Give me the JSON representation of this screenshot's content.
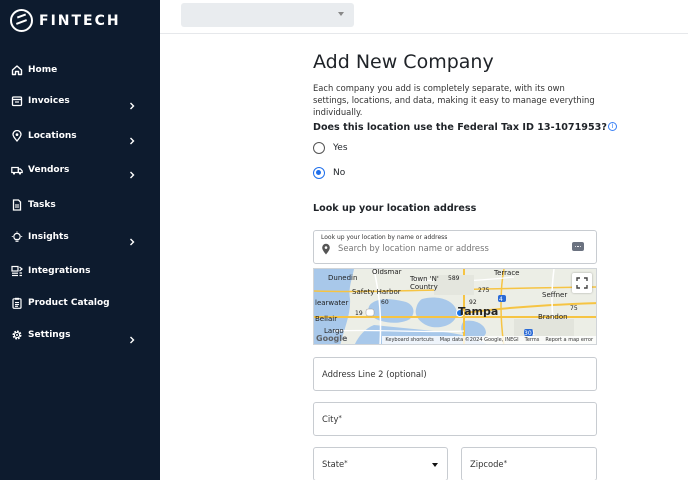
{
  "app": {
    "name": "FINTECH"
  },
  "sidebar": {
    "items": [
      {
        "label": "Home",
        "icon": "home-icon",
        "has_submenu": false
      },
      {
        "label": "Invoices",
        "icon": "invoice-icon",
        "has_submenu": true
      },
      {
        "label": "Locations",
        "icon": "location-pin-icon",
        "has_submenu": true
      },
      {
        "label": "Vendors",
        "icon": "truck-icon",
        "has_submenu": true
      },
      {
        "label": "Tasks",
        "icon": "document-icon",
        "has_submenu": false
      },
      {
        "label": "Insights",
        "icon": "lightbulb-icon",
        "has_submenu": true
      },
      {
        "label": "Integrations",
        "icon": "integrations-icon",
        "has_submenu": false
      },
      {
        "label": "Product Catalog",
        "icon": "clipboard-icon",
        "has_submenu": false
      },
      {
        "label": "Settings",
        "icon": "gear-icon",
        "has_submenu": true
      }
    ]
  },
  "page": {
    "title": "Add New Company",
    "description": "Each company you add is completely separate, with its own settings, locations, and data, making it easy to manage everything individually.",
    "tax_question": "Does this location use the Federal Tax ID 13-1071953?",
    "tax_options": [
      {
        "label": "Yes",
        "selected": false
      },
      {
        "label": "No",
        "selected": true
      }
    ],
    "address_section_title": "Look up your location address",
    "lookup": {
      "label": "Look up your location by name or address",
      "placeholder": "Search by location name or address"
    },
    "map": {
      "places": [
        "Oldsmar",
        "Dunedin",
        "Town 'N' Country",
        "Safety Harbor",
        "Terrace",
        "Seffner",
        "learwater",
        "Tampa",
        "Brandon",
        "Bellair",
        "Largo"
      ],
      "road_labels": [
        "60",
        "19",
        "92",
        "275",
        "4",
        "301",
        "589",
        "75"
      ],
      "attribution": [
        "Keyboard shortcuts",
        "Map data ©2024 Google, INEGI",
        "Terms",
        "Report a map error"
      ],
      "logo": "Google",
      "colors": {
        "water": "#a8c8ea",
        "land": "#eceee6",
        "highway": "#f6c443"
      }
    },
    "fields": {
      "address_line2": "Address Line 2 (optional)",
      "city": "City",
      "state": "State",
      "zipcode": "Zipcode",
      "required_mark": "*"
    }
  }
}
